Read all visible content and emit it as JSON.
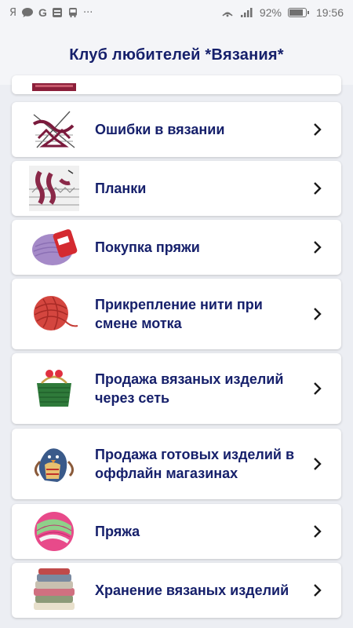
{
  "status_bar": {
    "left_icons": [
      "yandex-icon",
      "chat-icon",
      "google-icon",
      "vk-icon",
      "transport-icon",
      "more-icon"
    ],
    "left_glyphs": [
      "Я",
      "💬",
      "G",
      "▣",
      "▤",
      "···"
    ],
    "battery": "92%",
    "battery_level": 0.92,
    "time": "19:56"
  },
  "header": {
    "title": "Клуб любителей *Вязания*"
  },
  "items": [
    {
      "label": "",
      "icon": "knitting-top-thumb"
    },
    {
      "label": "Ошибки в вязании",
      "icon": "knitting-error-diagram-thumb"
    },
    {
      "label": "Планки",
      "icon": "knitting-band-thumb"
    },
    {
      "label": "Покупка пряжи",
      "icon": "yarn-purple-skein-thumb"
    },
    {
      "label": "Прикрепление нити при смене мотка",
      "icon": "yarn-red-ball-thumb"
    },
    {
      "label": "Продажа вязаных изделий через сеть",
      "icon": "green-knitted-purse-thumb"
    },
    {
      "label": "Продажа готовых изделий в оффлайн магазинах",
      "icon": "knitted-bird-toy-thumb"
    },
    {
      "label": "Пряжа",
      "icon": "yarn-pink-green-ball-thumb"
    },
    {
      "label": "Хранение вязаных изделий",
      "icon": "folded-sweaters-thumb"
    }
  ],
  "colors": {
    "title": "#16206b",
    "background": "#eceef3",
    "card": "#ffffff"
  }
}
